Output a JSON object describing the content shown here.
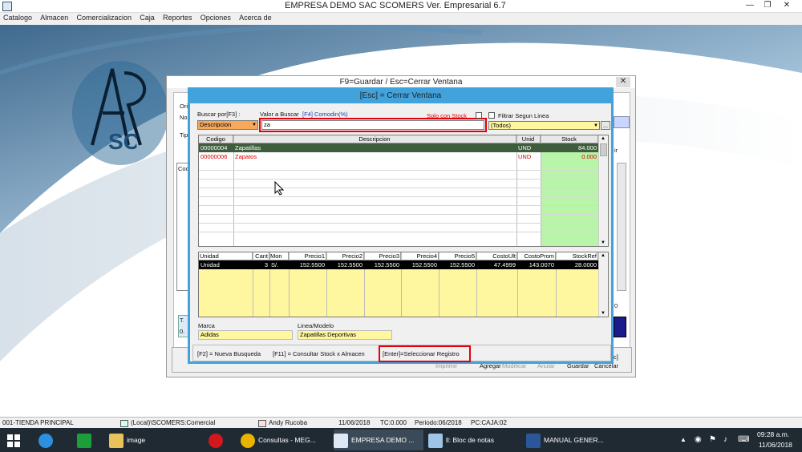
{
  "app": {
    "title": "EMPRESA DEMO SAC        SCOMERS Ver. Empresarial  6.7",
    "icon": "app-icon"
  },
  "menu": [
    "Catalogo",
    "Almacen",
    "Comercializacion",
    "Caja",
    "Reportes",
    "Opciones",
    "Acerca de"
  ],
  "background_logo_text": "SCOMERS",
  "outer_window": {
    "title": "F9=Guardar / Esc=Cerrar Ventana",
    "partial_labels": {
      "l1": "Ori",
      "l2": "No",
      "l3": "Tip",
      "l4": "Coc",
      "l5": "T.",
      "l6": "0.",
      "r1": "ir",
      "r2": "0"
    },
    "bottom_buttons": [
      "Imprimir",
      "Agregar",
      "Modificar",
      "Anular",
      "Guardar",
      "Cancelar"
    ],
    "partial_right": "c]"
  },
  "modal": {
    "title": "[Esc] = Cerrar Ventana",
    "buscar_por_label": "Buscar por[F3] :",
    "buscar_por_value": "Descripcion",
    "valor_label": "Valor a Buscar",
    "valor_hint": "[F4] Comodin(%)",
    "search_value": "za",
    "solo_stock_label": "Solo con Stock",
    "filtrar_label": "Filtrar Segun Linea",
    "linea_value": "(Todos)",
    "browse_label": "...",
    "products": {
      "headers": [
        "Codigo",
        "Descripcion",
        "Unid",
        "Stock"
      ],
      "rows": [
        {
          "codigo": "00000004",
          "descripcion": "Zapatillas",
          "unid": "UND",
          "stock": "84.000"
        },
        {
          "codigo": "00000006",
          "descripcion": "Zapatos",
          "unid": "UND",
          "stock": "0.000"
        }
      ]
    },
    "prices": {
      "headers": [
        "Unidad",
        "Cant",
        "Mon",
        "Precio1",
        "Precio2",
        "Precio3",
        "Precio4",
        "Precio5",
        "CostoUlt",
        "CostoProm",
        "StockRef"
      ],
      "rows": [
        [
          "Unidad",
          "3",
          "S/.",
          "152.5500",
          "152.5500",
          "152.5500",
          "152.5500",
          "152.5500",
          "47.4999",
          "143.0070",
          "28.0000"
        ]
      ]
    },
    "marca_label": "Marca",
    "marca_value": "Adidas",
    "linea_label": "Linea/Modelo",
    "linea_modelo_value": "Zapatillas Deportivas",
    "help_f2": "[F2] = Nueva Busqueda",
    "help_f11": "[F11] = Consultar Stock x Almacen",
    "help_enter": "[Enter]=Seleccionar Registro"
  },
  "status": {
    "tienda": "001-TIENDA PRINCIPAL",
    "db": "(Local)\\SCOMERS:Comercial",
    "user": "Andy Rucoba",
    "fecha": "11/06/2018",
    "tc": "TC:0.000",
    "periodo": "Periodo:06/2018",
    "pc": "PC:CAJA:02"
  },
  "taskbar": {
    "items": [
      {
        "label": "image",
        "icon": "folder-icon"
      },
      {
        "label": "Consultas - MEG...",
        "icon": "chrome-icon"
      },
      {
        "label": "EMPRESA DEMO ...",
        "icon": "scomers-icon"
      },
      {
        "label": "ll: Bloc de notas",
        "icon": "notepad-icon"
      },
      {
        "label": "MANUAL GENER...",
        "icon": "word-icon"
      }
    ],
    "time": "09:28 a.m.",
    "date": "11/06/2018",
    "colors": {
      "taskbar": "#1f2a33",
      "modal_frame": "#41a2dc",
      "highlight": "#3d5d3d",
      "stock_col": "#b8f5a8",
      "price_col": "#fff7a0"
    }
  }
}
